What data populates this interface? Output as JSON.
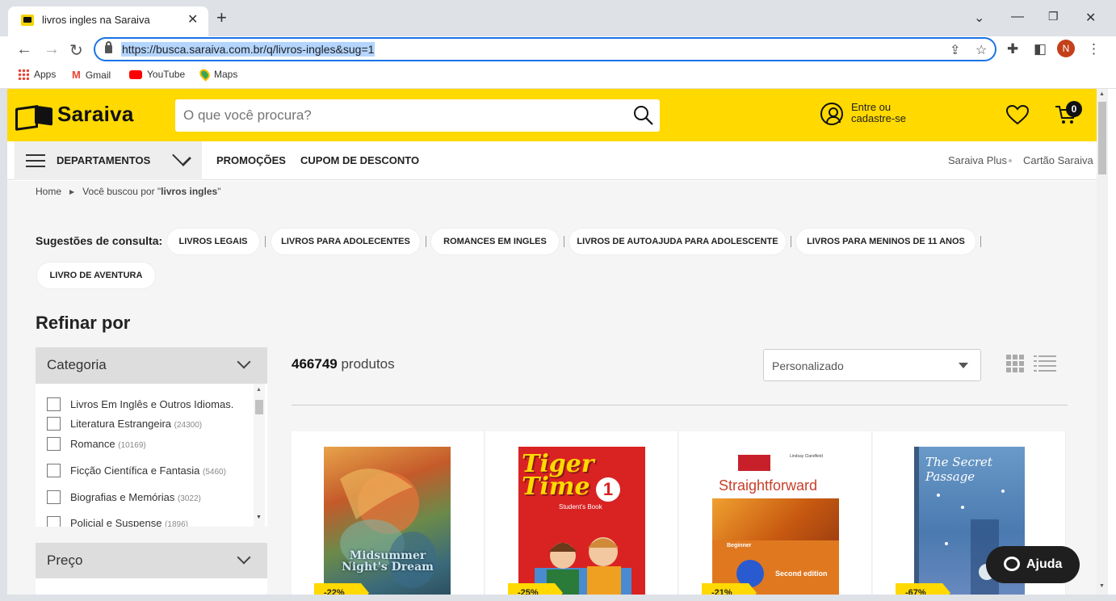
{
  "browser": {
    "tab_title": "livros ingles na Saraiva",
    "tab_close": "✕",
    "new_tab": "+",
    "url": "https://busca.saraiva.com.br/q/livros-ingles&sug=1",
    "profile_initial": "N",
    "bookmarks": [
      {
        "label": "Apps",
        "icon": "apps-icon"
      },
      {
        "label": "Gmail",
        "icon": "gmail-icon"
      },
      {
        "label": "YouTube",
        "icon": "youtube-icon"
      },
      {
        "label": "Maps",
        "icon": "maps-icon"
      }
    ]
  },
  "header": {
    "logo": "Saraiva",
    "search_placeholder": "O que você procura?",
    "login_line1": "Entre ou",
    "login_line2": "cadastre-se",
    "cart_count": "0",
    "brand_color": "#ffd900"
  },
  "nav": {
    "departments": "DEPARTAMENTOS",
    "promos": "PROMOÇÕES",
    "coupon": "CUPOM DE DESCONTO",
    "plus": "Saraiva Plus",
    "card": "Cartão Saraiva"
  },
  "breadcrumb": {
    "home": "Home",
    "searched_prefix": "Você buscou por \"",
    "searched_term": "livros ingles",
    "searched_suffix": "\""
  },
  "suggestions": {
    "label": "Sugestões de consulta:",
    "chips": [
      "LIVROS LEGAIS",
      "LIVROS PARA ADOLECENTES",
      "ROMANCES EM INGLES",
      "LIVROS DE AUTOAJUDA PARA ADOLESCENTE",
      "LIVROS PARA MENINOS DE 11 ANOS",
      "LIVRO DE AVENTURA"
    ]
  },
  "filters": {
    "title": "Refinar por",
    "category_title": "Categoria",
    "price_title": "Preço",
    "categories": [
      {
        "name": "Livros Em Inglês e Outros Idiomas.",
        "count": ""
      },
      {
        "name": "Literatura Estrangeira",
        "count": "(24300)"
      },
      {
        "name": "Romance",
        "count": "(10169)"
      },
      {
        "name": "Ficção Científica e Fantasia",
        "count": "(5460)"
      },
      {
        "name": "Biografias e Memórias",
        "count": "(3022)"
      },
      {
        "name": "Policial e Suspense",
        "count": "(1896)"
      }
    ]
  },
  "results": {
    "count": "466749",
    "count_label": "produtos",
    "sort_selected": "Personalizado"
  },
  "products": [
    {
      "cover_title": "Midsummer Night's Dream",
      "discount": "-22%"
    },
    {
      "cover_title": "Tiger Time",
      "cover_subtitle": "Student's Book",
      "discount": "-25%"
    },
    {
      "cover_title": "Straightforward",
      "cover_subtitle": "Beginner",
      "cover_author": "Lindsay Clandfield",
      "cover_note": "Second edition",
      "discount": "-21%"
    },
    {
      "cover_title": "The Secret Passage",
      "discount": "-67%"
    }
  ],
  "help": {
    "label": "Ajuda"
  }
}
